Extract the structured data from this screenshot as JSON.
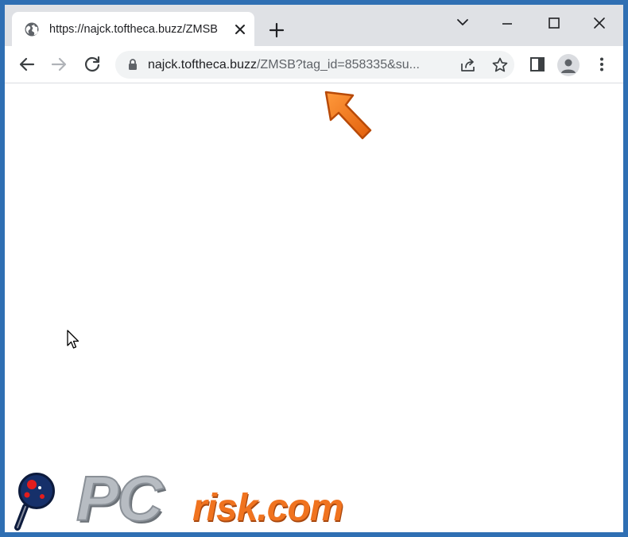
{
  "browser": {
    "tab": {
      "title": "https://najck.toftheca.buzz/ZMSB",
      "favicon_icon": "globe-icon",
      "close_icon": "close-icon"
    },
    "new_tab_icon": "plus-icon",
    "window_controls": {
      "menu_icon": "chevron-down-icon",
      "minimize_icon": "minimize-icon",
      "maximize_icon": "maximize-icon",
      "close_icon": "close-icon"
    },
    "toolbar": {
      "back_icon": "back-arrow-icon",
      "forward_icon": "forward-arrow-icon",
      "reload_icon": "reload-icon",
      "omnibox": {
        "lock_icon": "lock-icon",
        "url_host": "najck.toftheca.buzz",
        "url_rest": "/ZMSB?tag_id=858335&su...",
        "share_icon": "share-icon",
        "bookmark_icon": "star-icon"
      },
      "side_panel_icon": "side-panel-icon",
      "profile_icon": "profile-avatar-icon",
      "menu_icon": "kebab-menu-icon"
    }
  },
  "overlay": {
    "arrow_color": "#f5781e",
    "watermark": {
      "text_pc": "PC",
      "text_risk": "risk.com",
      "risk_color": "#f0731f"
    }
  }
}
